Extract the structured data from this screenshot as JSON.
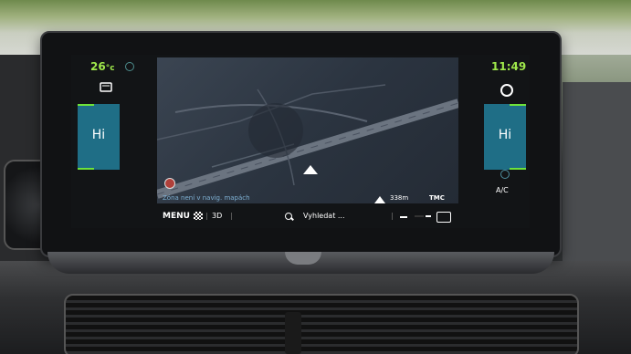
{
  "climate_left": {
    "temperature": "26",
    "unit": "°c",
    "fan_label": "Hi"
  },
  "climate_right": {
    "time": "11:49",
    "fan_label": "Hi",
    "ac_label": "A/C"
  },
  "map": {
    "status_message": "Zóna není v navig. mapách",
    "distance": "338m",
    "traffic_label": "TMC"
  },
  "nav_bar": {
    "menu_label": "MENU",
    "view_3d_label": "3D",
    "search_label": "Vyhledat ...",
    "separator": "|"
  },
  "icons": [
    "fan-icon",
    "seat-heat-icon",
    "compass-icon",
    "checkered-flag-icon",
    "search-icon",
    "zoom-out-icon",
    "zoom-in-icon",
    "map-layers-icon",
    "settings-icon",
    "fan-small-icon",
    "warning-icon"
  ],
  "colors": {
    "clock_green": "#9fe84b",
    "fan_blue": "#1f6e86",
    "status_text": "#7fb1d4"
  }
}
